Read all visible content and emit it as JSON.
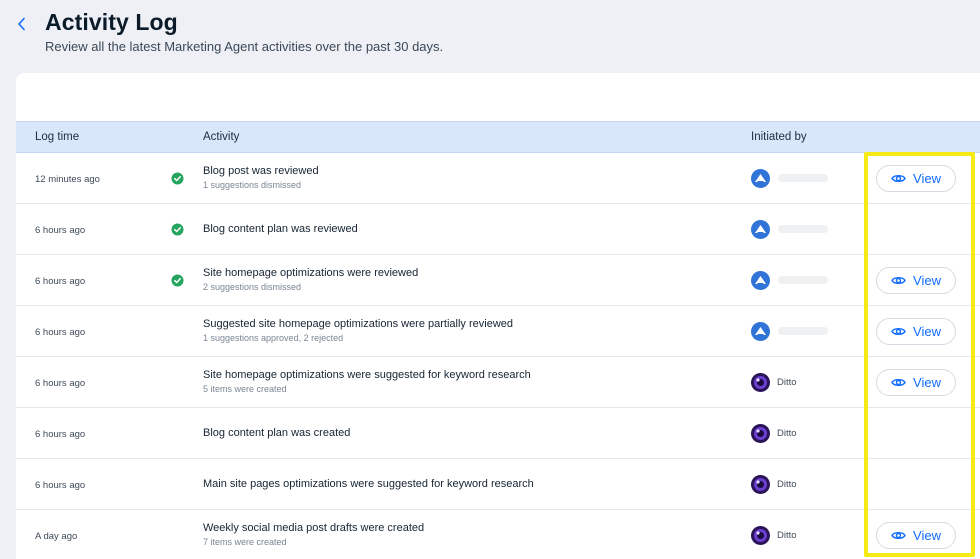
{
  "header": {
    "title": "Activity Log",
    "subtitle": "Review all the latest Marketing Agent activities over the past 30 days."
  },
  "table": {
    "columns": {
      "log_time": "Log time",
      "activity": "Activity",
      "initiated_by": "Initiated by"
    },
    "view_label": "View",
    "rows": [
      {
        "time": "12 minutes ago",
        "status": "check",
        "title": "Blog post was reviewed",
        "subtitle": "1 suggestions dismissed",
        "initiator": "user",
        "name": "",
        "view": true
      },
      {
        "time": "6 hours ago",
        "status": "check",
        "title": "Blog content plan was reviewed",
        "subtitle": "",
        "initiator": "user",
        "name": "",
        "view": false
      },
      {
        "time": "6 hours ago",
        "status": "check",
        "title": "Site homepage optimizations were reviewed",
        "subtitle": "2 suggestions dismissed",
        "initiator": "user",
        "name": "",
        "view": true
      },
      {
        "time": "6 hours ago",
        "status": "",
        "title": "Suggested site homepage optimizations were partially reviewed",
        "subtitle": "1 suggestions approved, 2 rejected",
        "initiator": "user",
        "name": "",
        "view": true
      },
      {
        "time": "6 hours ago",
        "status": "",
        "title": "Site homepage optimizations were suggested for keyword research",
        "subtitle": "5 items were created",
        "initiator": "bot",
        "name": "Ditto",
        "view": true
      },
      {
        "time": "6 hours ago",
        "status": "",
        "title": "Blog content plan was created",
        "subtitle": "",
        "initiator": "bot",
        "name": "Ditto",
        "view": false
      },
      {
        "time": "6 hours ago",
        "status": "",
        "title": "Main site pages optimizations were suggested for keyword research",
        "subtitle": "",
        "initiator": "bot",
        "name": "Ditto",
        "view": false
      },
      {
        "time": "A day ago",
        "status": "",
        "title": "Weekly social media post drafts were created",
        "subtitle": "7 items were created",
        "initiator": "bot",
        "name": "Ditto",
        "view": true
      }
    ]
  },
  "colors": {
    "accent": "#116dff",
    "success": "#25a55f",
    "highlight": "#f6ea15",
    "header_row": "#d9e7fb"
  },
  "icons": {
    "back": "chevron-left-icon",
    "status": "check-circle-icon",
    "view": "eye-icon"
  }
}
